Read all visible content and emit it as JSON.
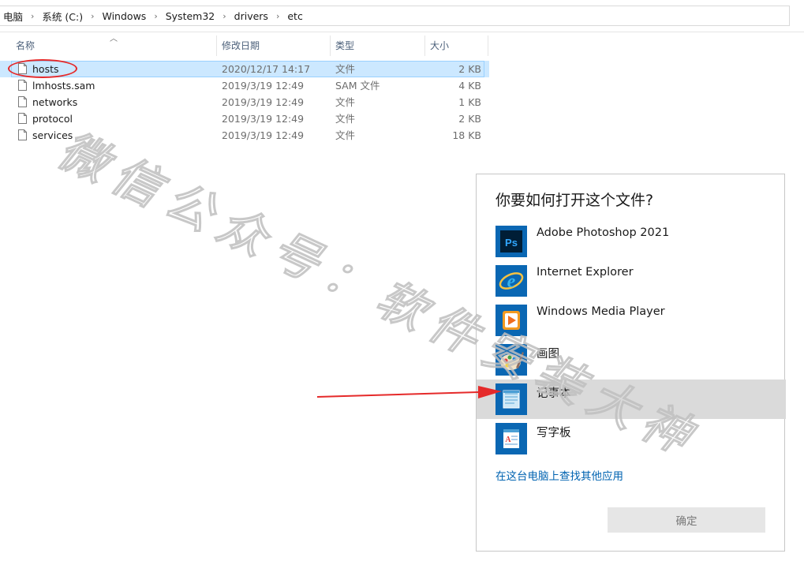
{
  "breadcrumb": {
    "items": [
      "电脑",
      "系统 (C:)",
      "Windows",
      "System32",
      "drivers",
      "etc"
    ]
  },
  "columns": {
    "name": "名称",
    "date": "修改日期",
    "type": "类型",
    "size": "大小"
  },
  "files": [
    {
      "name": "hosts",
      "date": "2020/12/17 14:17",
      "type": "文件",
      "size": "2 KB",
      "selected": true
    },
    {
      "name": "lmhosts.sam",
      "date": "2019/3/19 12:49",
      "type": "SAM 文件",
      "size": "4 KB"
    },
    {
      "name": "networks",
      "date": "2019/3/19 12:49",
      "type": "文件",
      "size": "1 KB"
    },
    {
      "name": "protocol",
      "date": "2019/3/19 12:49",
      "type": "文件",
      "size": "2 KB"
    },
    {
      "name": "services",
      "date": "2019/3/19 12:49",
      "type": "文件",
      "size": "18 KB"
    }
  ],
  "watermark": {
    "text": "微信公众号：软件安装大神"
  },
  "dialog": {
    "title": "你要如何打开这个文件?",
    "apps": [
      {
        "label": "Adobe Photoshop 2021",
        "icon": "photoshop-icon"
      },
      {
        "label": "Internet Explorer",
        "icon": "internet-explorer-icon"
      },
      {
        "label": "Windows Media Player",
        "icon": "windows-media-player-icon"
      },
      {
        "label": "画图",
        "icon": "paint-icon"
      },
      {
        "label": "记事本",
        "icon": "notepad-icon"
      },
      {
        "label": "写字板",
        "icon": "wordpad-icon"
      }
    ],
    "more_link": "在这台电脑上查找其他应用",
    "ok_label": "确定"
  },
  "colors": {
    "selection": "#cce8ff",
    "highlight_row": "#dadada",
    "link": "#0063b1",
    "annotation": "#e52a2a"
  }
}
